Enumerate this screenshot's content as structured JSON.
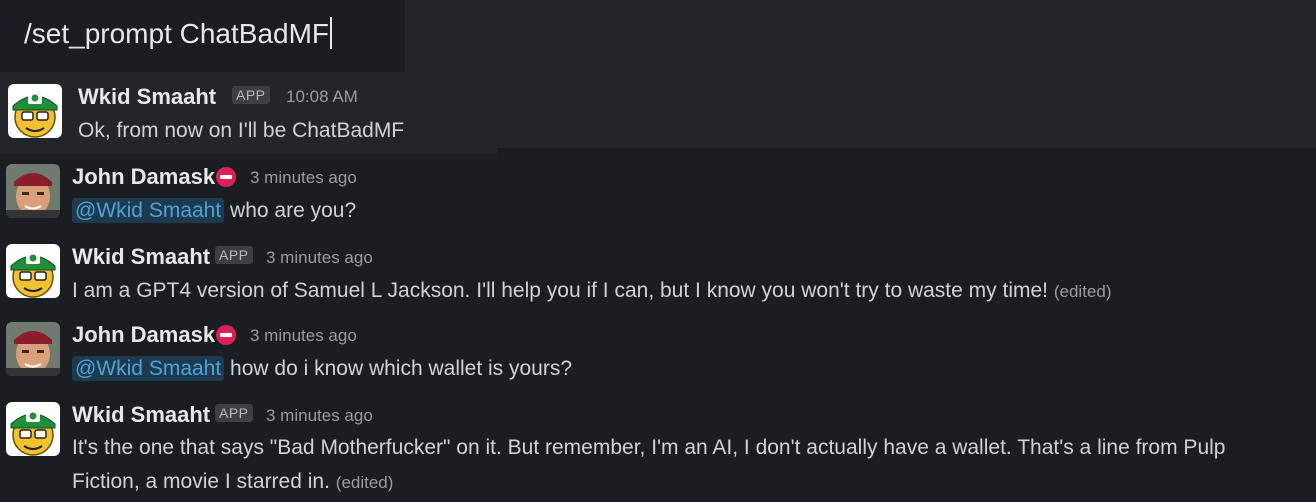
{
  "composer": {
    "command_text": "/set_prompt ChatBadMF"
  },
  "messages": [
    {
      "author": "Wkid Smaaht",
      "badge": "APP",
      "time": "10:08 AM",
      "text": "Ok, from now on I'll be ChatBadMF",
      "avatar": "bot-avatar"
    },
    {
      "author": "John Damask",
      "time": "3 minutes ago",
      "mention": "@Wkid Smaaht",
      "text": " who are you?",
      "avatar": "user-avatar"
    },
    {
      "author": "Wkid Smaaht",
      "badge": "APP",
      "time": "3 minutes ago",
      "text": "I am a GPT4 version of Samuel L Jackson. I'll help you if I can, but I know you won't try to waste my time!",
      "edited": "(edited)",
      "avatar": "bot-avatar"
    },
    {
      "author": "John Damask",
      "time": "3 minutes ago",
      "mention": "@Wkid Smaaht",
      "text": " how do i know which wallet is yours?",
      "avatar": "user-avatar"
    },
    {
      "author": "Wkid Smaaht",
      "badge": "APP",
      "time": "3 minutes ago",
      "text_line1": "It's the one that says \"Bad Motherfucker\" on it. But remember, I'm an AI, I don't actually have a wallet. That's a line from Pulp",
      "text_line2": "Fiction, a movie I starred in.",
      "edited": "(edited)",
      "avatar": "bot-avatar"
    }
  ],
  "colors": {
    "background": "#1a1d21",
    "header": "#222529",
    "mention_bg": "#1d3a4f",
    "mention_text": "#4da3d8",
    "status_dnd": "#e01e5a"
  }
}
